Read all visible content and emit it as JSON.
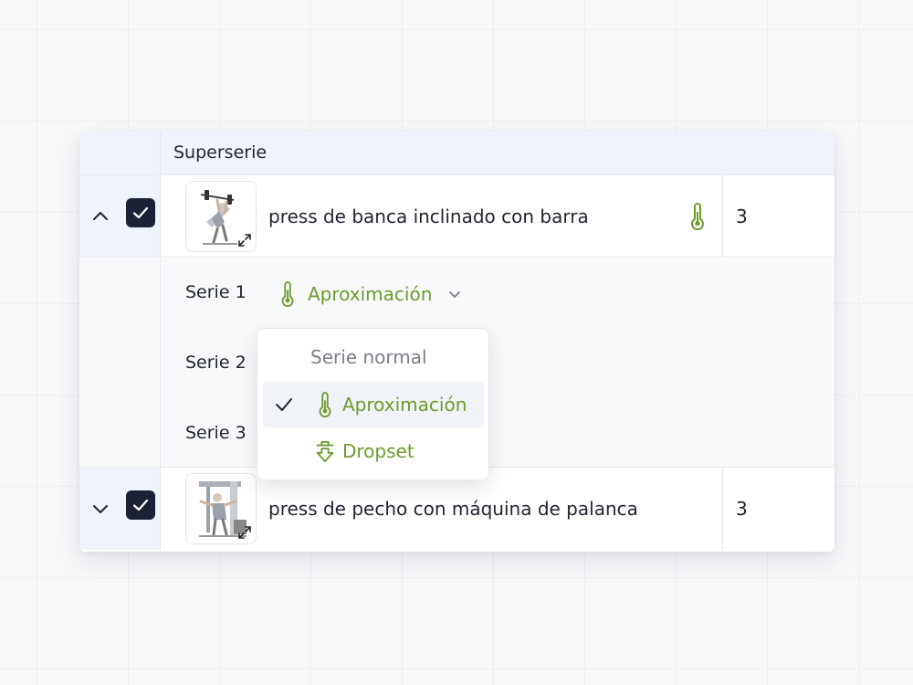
{
  "header": {
    "title": "Superserie"
  },
  "exercises": [
    {
      "name": "press de banca inclinado con barra",
      "sets": "3",
      "expanded": true,
      "checked": true,
      "indicator": "thermometer-icon"
    },
    {
      "name": "press de pecho con máquina de palanca",
      "sets": "3",
      "expanded": false,
      "checked": true
    }
  ],
  "series": [
    {
      "label": "Serie 1",
      "type": "Aproximación"
    },
    {
      "label": "Serie 2"
    },
    {
      "label": "Serie 3"
    }
  ],
  "dropdown": {
    "options": [
      {
        "label": "Serie normal",
        "selected": false
      },
      {
        "label": "Aproximación",
        "selected": true,
        "icon": "thermometer-icon"
      },
      {
        "label": "Dropset",
        "selected": false,
        "icon": "dropset-arrow-icon"
      }
    ]
  },
  "colors": {
    "accent_green": "#6e9b2d",
    "checkbox_dark": "#1b2236",
    "header_bg": "#eef3fc"
  }
}
